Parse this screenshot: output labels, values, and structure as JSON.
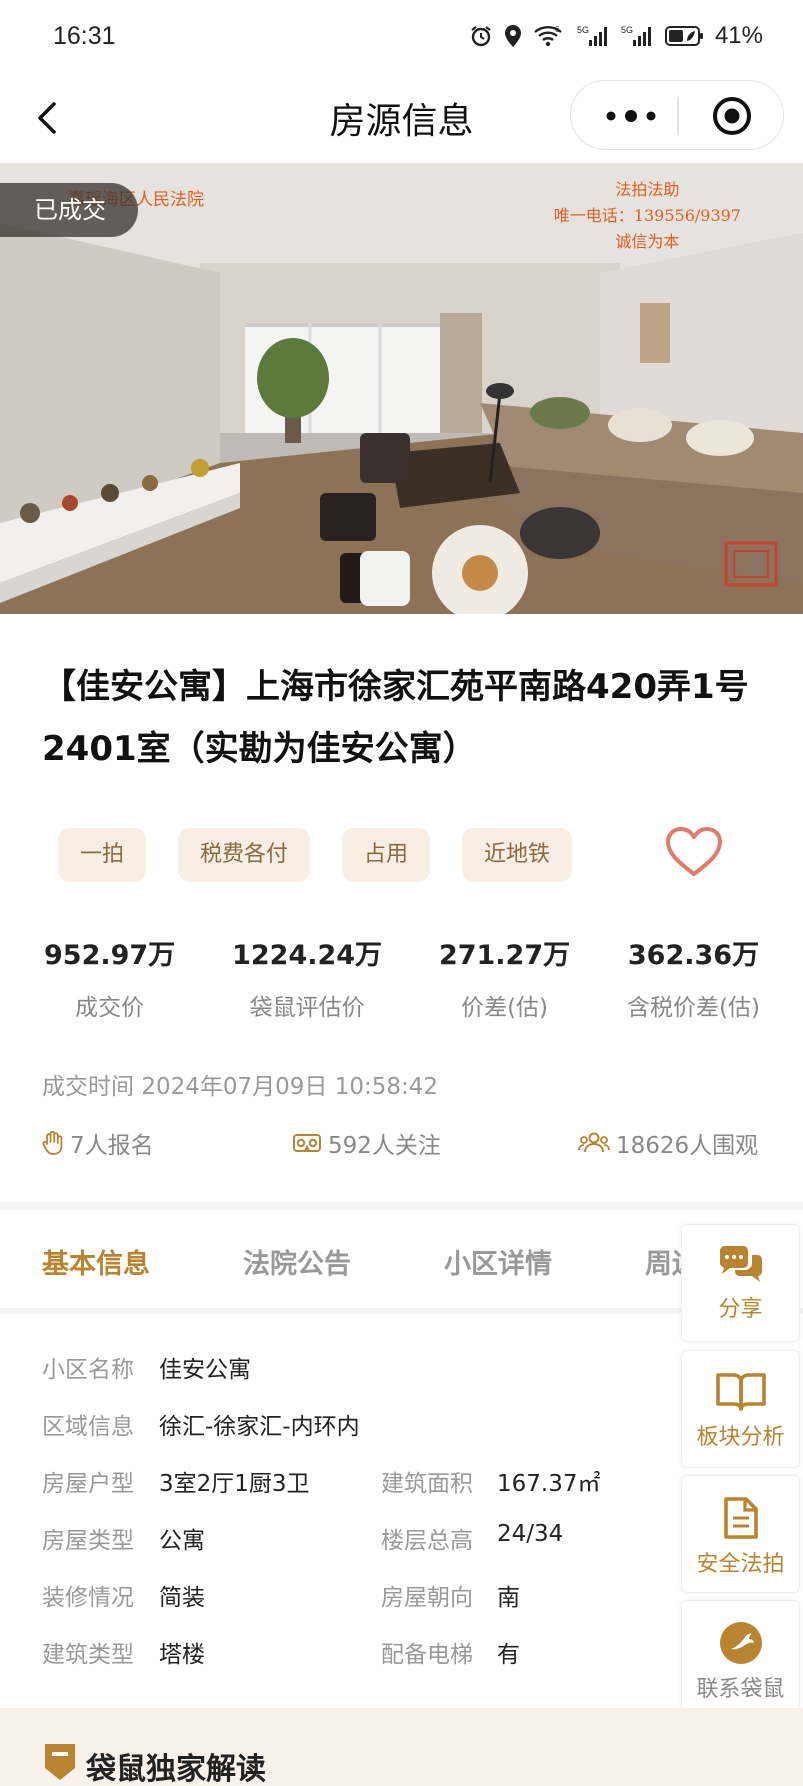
{
  "status_bar": {
    "time": "16:31",
    "battery": "41%",
    "icons": [
      "alarm-icon",
      "location-icon",
      "wifi-icon",
      "signal-5g-icon",
      "signal-5g-icon",
      "battery-icon"
    ]
  },
  "nav": {
    "title": "房源信息",
    "back_icon": "chevron-left-icon",
    "more_icon": "more-dots-icon",
    "close_icon": "target-icon"
  },
  "photo": {
    "status_badge": "已成交",
    "court_text": "嘉瑶海区人民法院",
    "watermark_lines": [
      "法拍法助",
      "唯一电话：139556/9397",
      "诚信为本"
    ]
  },
  "listing": {
    "title": "【佳安公寓】上海市徐家汇苑平南路420弄1号2401室（实勘为佳安公寓）",
    "tags": [
      "一拍",
      "税费各付",
      "占用",
      "近地铁"
    ],
    "favorite_icon": "heart-icon",
    "stats": [
      {
        "value": "952.97万",
        "label": "成交价"
      },
      {
        "value": "1224.24万",
        "label": "袋鼠评估价"
      },
      {
        "value": "271.27万",
        "label": "价差(估)"
      },
      {
        "value": "362.36万",
        "label": "含税价差(估)"
      }
    ],
    "deal_time_label": "成交时间",
    "deal_time": "2024年07月09日 10:58:42",
    "counters": [
      {
        "icon": "hand-icon",
        "text": "7人报名"
      },
      {
        "icon": "vr-glasses-icon",
        "text": "592人关注"
      },
      {
        "icon": "people-icon",
        "text": "18626人围观"
      }
    ]
  },
  "tabs": [
    "基本信息",
    "法院公告",
    "小区详情",
    "周边"
  ],
  "info": {
    "rows": [
      {
        "k": "小区名称",
        "v": "佳安公寓"
      },
      {
        "k": "区域信息",
        "v": "徐汇-徐家汇-内环内"
      },
      {
        "k": "房屋户型",
        "v": "3室2厅1厨3卫",
        "k2": "建筑面积",
        "v2": "167.37㎡"
      },
      {
        "k": "房屋类型",
        "v": "公寓",
        "k2": "楼层总高",
        "v2": "24/34"
      },
      {
        "k": "装修情况",
        "v": "简装",
        "k2": "房屋朝向",
        "v2": "南"
      },
      {
        "k": "建筑类型",
        "v": "塔楼",
        "k2": "配备电梯",
        "v2": "有"
      }
    ]
  },
  "side_buttons": [
    {
      "icon": "chat-icon",
      "label": "分享"
    },
    {
      "icon": "book-icon",
      "label": "板块分析"
    },
    {
      "icon": "document-icon",
      "label": "安全法拍"
    },
    {
      "icon": "kangaroo-logo-icon",
      "label": "联系袋鼠"
    }
  ],
  "section": {
    "title": "袋鼠独家解读"
  },
  "colors": {
    "accent": "#b8842f",
    "tag_bg": "#f8eee4",
    "tag_text": "#8a6a3e",
    "heart": "#e07a6a"
  }
}
